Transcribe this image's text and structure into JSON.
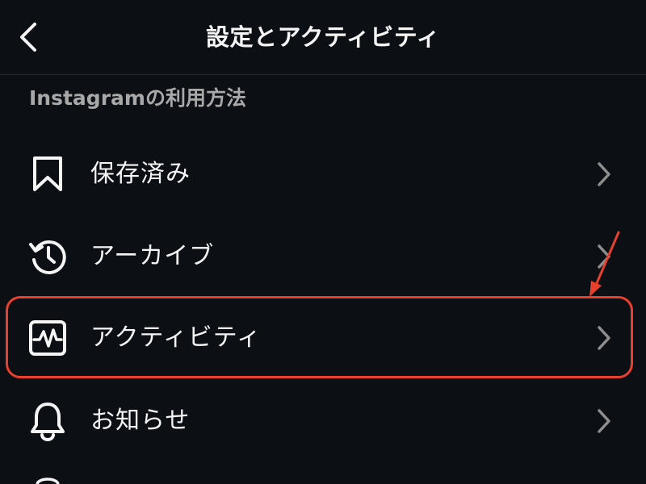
{
  "header": {
    "title": "設定とアクティビティ",
    "back_icon": "chevron-left-icon"
  },
  "section": {
    "title": "Instagramの利用方法"
  },
  "menu": {
    "items": [
      {
        "label": "保存済み",
        "icon": "bookmark-icon"
      },
      {
        "label": "アーカイブ",
        "icon": "archive-history-icon"
      },
      {
        "label": "アクティビティ",
        "icon": "activity-icon",
        "highlighted": true
      },
      {
        "label": "お知らせ",
        "icon": "bell-icon"
      }
    ]
  },
  "colors": {
    "background": "#0c1014",
    "text": "#f5f5f5",
    "section_text": "#a8a8a8",
    "chevron": "#8e8e8e",
    "annotation": "#e8402c"
  }
}
